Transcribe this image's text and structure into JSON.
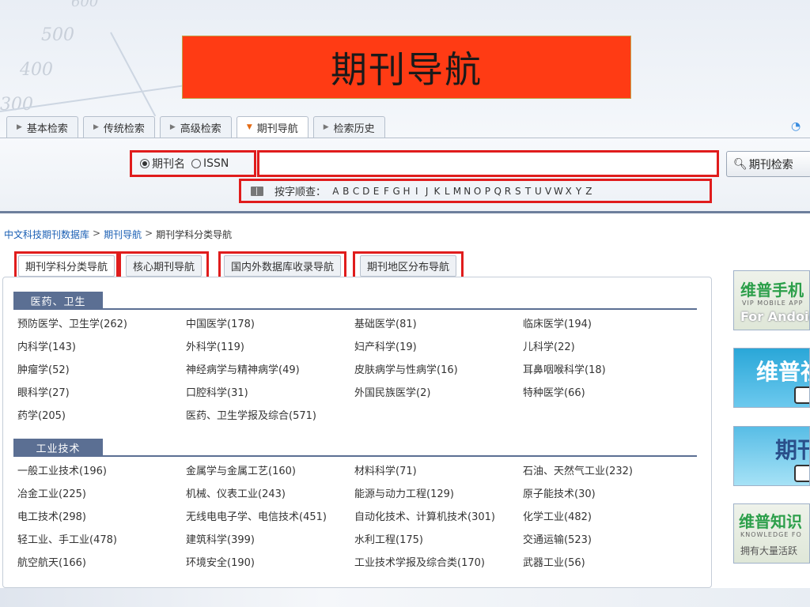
{
  "banner": {
    "title": "期刊导航"
  },
  "background": {
    "numbers": [
      "500",
      "400",
      "300",
      "600"
    ]
  },
  "top_tabs": [
    {
      "label": "基本检索",
      "active": false
    },
    {
      "label": "传统检索",
      "active": false
    },
    {
      "label": "高级检索",
      "active": false
    },
    {
      "label": "期刊导航",
      "active": true
    },
    {
      "label": "检索历史",
      "active": false
    }
  ],
  "search": {
    "radio_options": [
      {
        "label": "期刊名",
        "checked": true
      },
      {
        "label": "ISSN",
        "checked": false
      }
    ],
    "input_value": "",
    "button_label": "期刊检索",
    "alpha_label": "按字顺查：",
    "letters": [
      "A",
      "B",
      "C",
      "D",
      "E",
      "F",
      "G",
      "H",
      "I",
      "J",
      "K",
      "L",
      "M",
      "N",
      "O",
      "P",
      "Q",
      "R",
      "S",
      "T",
      "U",
      "V",
      "W",
      "X",
      "Y",
      "Z"
    ]
  },
  "breadcrumb": {
    "items": [
      "中文科技期刊数据库",
      "期刊导航",
      "期刊学科分类导航"
    ],
    "sep": ">"
  },
  "sub_tabs": [
    {
      "label": "期刊学科分类导航",
      "active": true
    },
    {
      "label": "核心期刊导航",
      "active": false
    },
    {
      "label": "国内外数据库收录导航",
      "active": false
    },
    {
      "label": "期刊地区分布导航",
      "active": false
    }
  ],
  "sections": [
    {
      "title": "医药、卫生",
      "items": [
        "预防医学、卫生学(262)",
        "中国医学(178)",
        "基础医学(81)",
        "临床医学(194)",
        "内科学(143)",
        "外科学(119)",
        "妇产科学(19)",
        "儿科学(22)",
        "肿瘤学(52)",
        "神经病学与精神病学(49)",
        "皮肤病学与性病学(16)",
        "耳鼻咽喉科学(18)",
        "眼科学(27)",
        "口腔科学(31)",
        "外国民族医学(2)",
        "特种医学(66)",
        "药学(205)",
        "医药、卫生学报及综合(571)"
      ]
    },
    {
      "title": "工业技术",
      "items": [
        "一般工业技术(196)",
        "金属学与金属工艺(160)",
        "材料科学(71)",
        "石油、天然气工业(232)",
        "冶金工业(225)",
        "机械、仪表工业(243)",
        "能源与动力工程(129)",
        "原子能技术(30)",
        "电工技术(298)",
        "无线电电子学、电信技术(451)",
        "自动化技术、计算机技术(301)",
        "化学工业(482)",
        "轻工业、手工业(478)",
        "建筑科学(399)",
        "水利工程(175)",
        "交通运输(523)",
        "航空航天(166)",
        "环境安全(190)",
        "工业技术学报及综合类(170)",
        "武器工业(56)"
      ]
    }
  ],
  "ads": {
    "ad1_title": "维普手机",
    "ad1_sub": "VIP MOBILE APP",
    "ad1_sub2": "For Andoid",
    "ad2_title": "维普社",
    "ad3_title": "期刊",
    "ad4_title": "维普知识",
    "ad4_sub": "KNOWLEDGE FO",
    "ad4_sub2": "拥有大量活跃"
  },
  "colors": {
    "accent_red": "#e01c1c",
    "banner": "#ff3b14",
    "section": "#5b6f93",
    "link": "#1a5fb4"
  }
}
